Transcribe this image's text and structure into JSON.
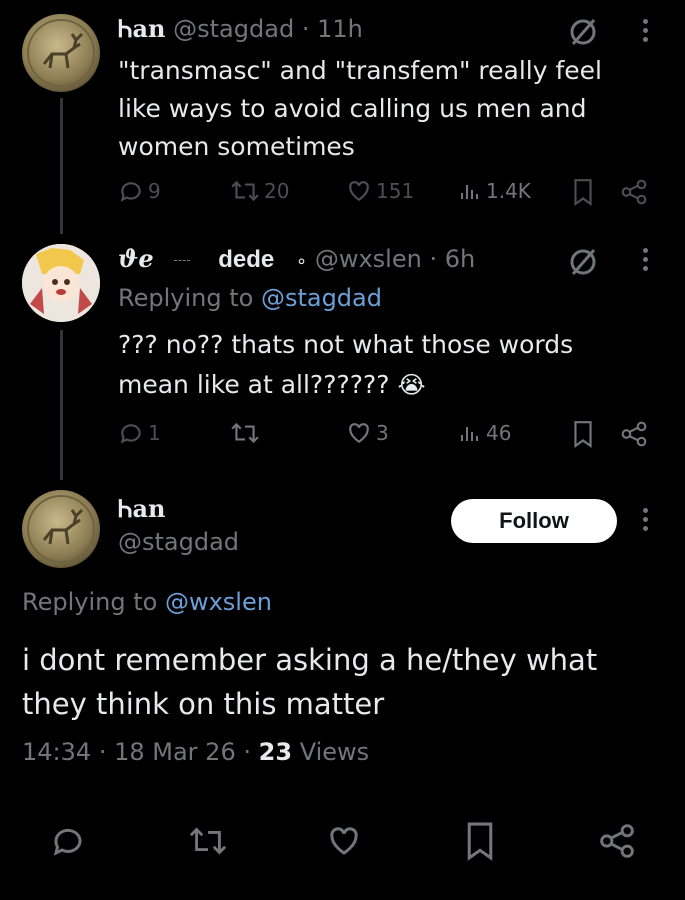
{
  "tweets": [
    {
      "display_name": "Ꮒan",
      "handle": "@stagdad",
      "time": "11h",
      "text": "\"transmasc\" and \"transfem\" really feel like ways to avoid calling us men and women sometimes",
      "stats": {
        "replies": "9",
        "reposts": "20",
        "likes": "151",
        "views": "1.4K"
      }
    },
    {
      "display_name_glyph": "ϑe",
      "display_name_dashes": "----",
      "display_name": "dede",
      "display_name_dot": "∘",
      "handle": "@wxslen",
      "time": "6h",
      "replying_label": "Replying to",
      "replying_to": "@stagdad",
      "text": "??? no?? thats not what those words mean like at all??????",
      "emoji": "😭",
      "stats": {
        "replies": "1",
        "reposts": "",
        "likes": "3",
        "views": "46"
      }
    }
  ],
  "main": {
    "display_name": "Ꮒan",
    "handle": "@stagdad",
    "follow_label": "Follow",
    "replying_label": "Replying to",
    "replying_to": "@wxslen",
    "text": "i dont remember asking a he/they what they think on this matter",
    "time": "14:34",
    "date": "18 Mar 26",
    "views_count": "23",
    "views_label": "Views"
  },
  "icons": [
    "reply-icon",
    "repost-icon",
    "like-icon",
    "views-icon",
    "bookmark-icon",
    "share-icon",
    "muted-conversation-icon",
    "more-icon"
  ],
  "colors": {
    "background": "#000000",
    "text": "#e7e9ea",
    "muted": "#71767b",
    "link": "#6b9fd8",
    "follow_bg": "#ffffff"
  }
}
